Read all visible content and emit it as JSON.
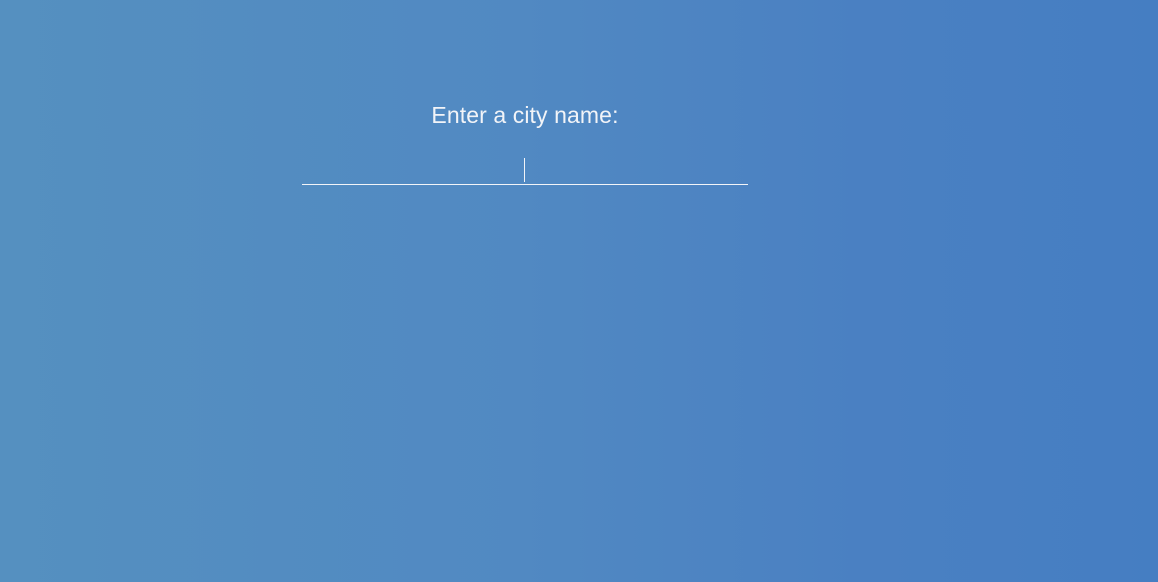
{
  "prompt": {
    "label": "Enter a city name:"
  },
  "city_input": {
    "value": "",
    "placeholder": ""
  },
  "colors": {
    "background_left": "#5590c0",
    "background_right": "#457ec2",
    "text": "#f2f4f8"
  }
}
